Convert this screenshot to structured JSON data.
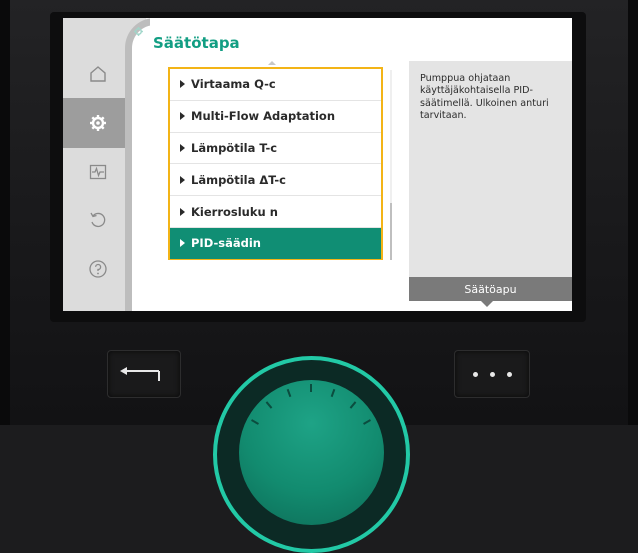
{
  "screen": {
    "title": "Säätötapa",
    "nav": [
      {
        "name": "home-icon",
        "active": false
      },
      {
        "name": "settings-gear-icon",
        "active": true
      },
      {
        "name": "diagnostics-icon",
        "active": false
      },
      {
        "name": "restore-icon",
        "active": false
      },
      {
        "name": "help-icon",
        "active": false
      }
    ],
    "menu_items": [
      {
        "label": "Virtaama Q-c",
        "selected": false
      },
      {
        "label": "Multi-Flow Adaptation",
        "selected": false
      },
      {
        "label": "Lämpötila T-c",
        "selected": false
      },
      {
        "label": "Lämpötila ΔT-c",
        "selected": false
      },
      {
        "label": "Kierrosluku n",
        "selected": false
      },
      {
        "label": "PID-säädin",
        "selected": true
      }
    ],
    "help": {
      "text": "Pumppua ohjataan käyttäjäkohtaisella PID-säätimellä. Ulkoinen anturi tarvitaan.",
      "tab_label": "Säätöapu"
    }
  },
  "controls": {
    "back_icon": "back-arrow-icon",
    "menu_icon": "more-dots-icon",
    "knob": "control-knob"
  },
  "colors": {
    "accent": "#129e83",
    "selection": "#108e74",
    "focus_border": "#f3b417",
    "knob_ring": "#22c9a6"
  }
}
